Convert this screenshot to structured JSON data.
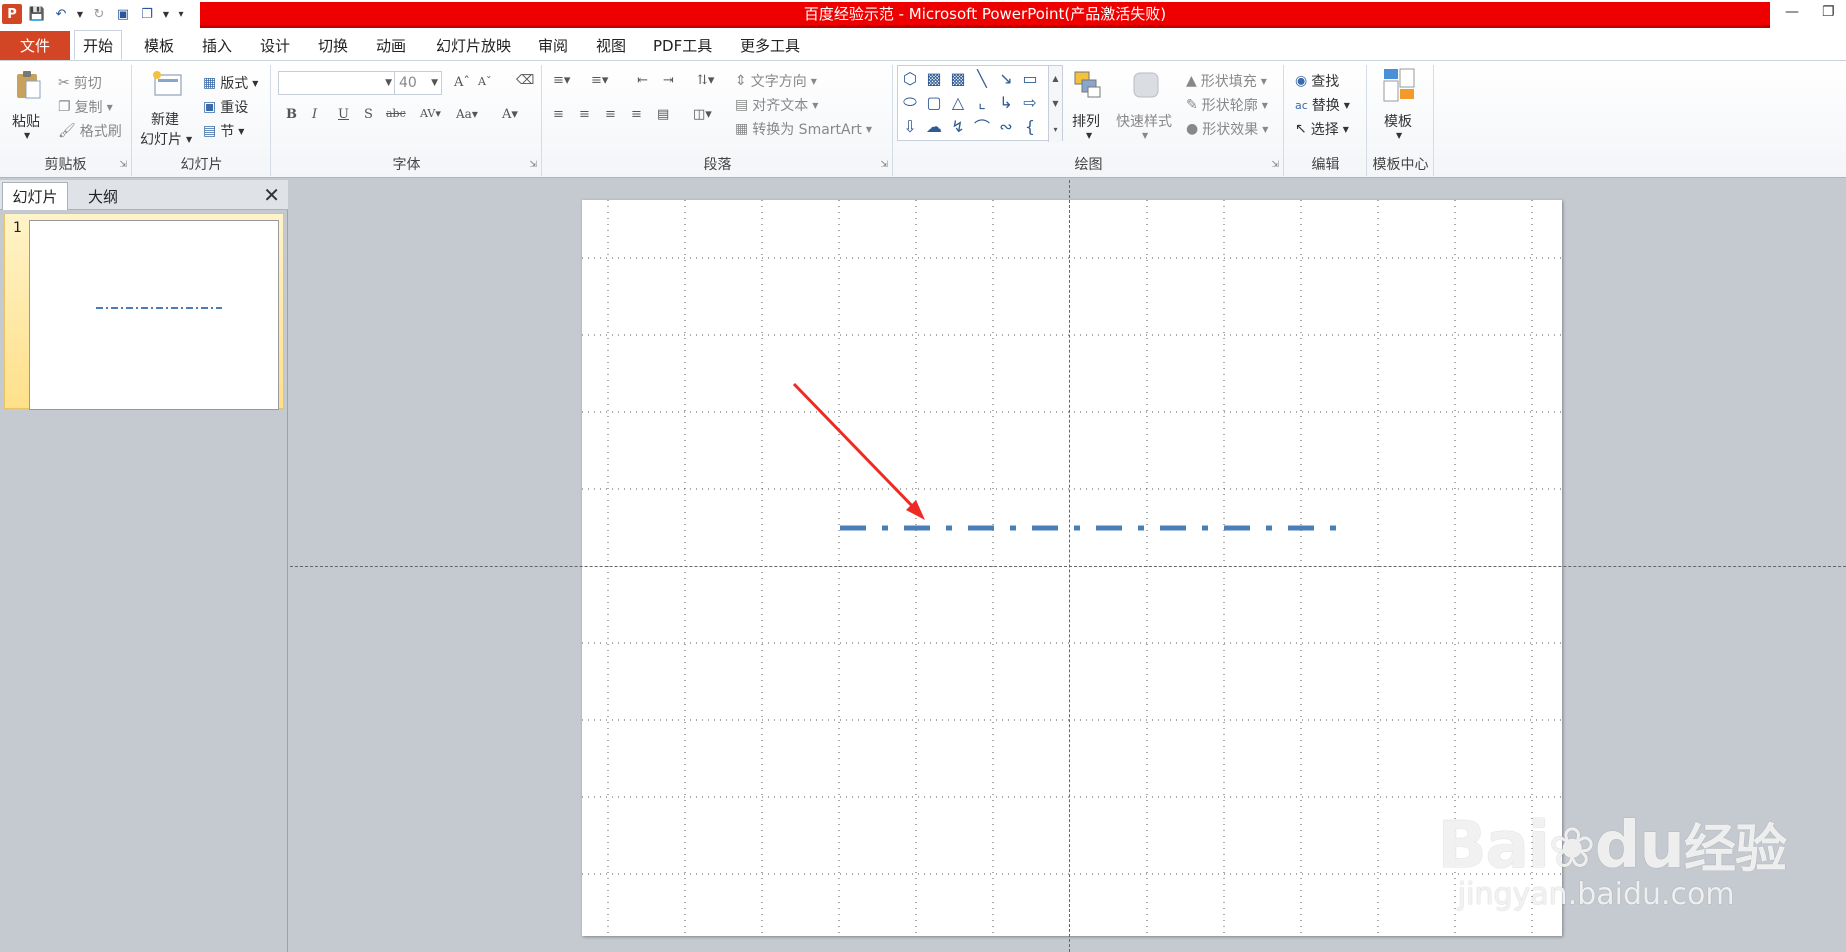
{
  "window": {
    "title": "百度经验示范 - Microsoft PowerPoint(产品激活失败)",
    "app_icon_letter": "P"
  },
  "ribbon_tabs": [
    "文件",
    "开始",
    "模板",
    "插入",
    "设计",
    "切换",
    "动画",
    "幻灯片放映",
    "审阅",
    "视图",
    "PDF工具",
    "更多工具"
  ],
  "ribbon": {
    "clipboard": {
      "paste": "粘贴",
      "cut": "剪切",
      "copy": "复制",
      "format_painter": "格式刷",
      "label": "剪贴板"
    },
    "slides": {
      "new_slide_line1": "新建",
      "new_slide_line2": "幻灯片",
      "layout": "版式",
      "reset": "重设",
      "section": "节",
      "label": "幻灯片"
    },
    "font": {
      "font_name": "",
      "font_size": "40",
      "label": "字体"
    },
    "paragraph": {
      "text_direction": "文字方向",
      "align_text": "对齐文本",
      "convert_smartart": "转换为 SmartArt",
      "label": "段落"
    },
    "drawing": {
      "arrange": "排列",
      "quick_styles": "快速样式",
      "shape_fill": "形状填充",
      "shape_outline": "形状轮廓",
      "shape_effects": "形状效果",
      "label": "绘图"
    },
    "editing": {
      "find": "查找",
      "replace": "替换",
      "select": "选择",
      "label": "编辑"
    },
    "template_center": {
      "template": "模板",
      "label": "模板中心"
    }
  },
  "panel": {
    "tab_slides": "幻灯片",
    "tab_outline": "大纲",
    "slide_number": "1"
  },
  "slide": {
    "line_color": "#4a7ebb",
    "arrow_color": "#ee2a24"
  },
  "watermark": {
    "brand_latin": "Bai",
    "brand_du": "du",
    "brand_cn": "经验",
    "url": "jingyan.baidu.com"
  }
}
